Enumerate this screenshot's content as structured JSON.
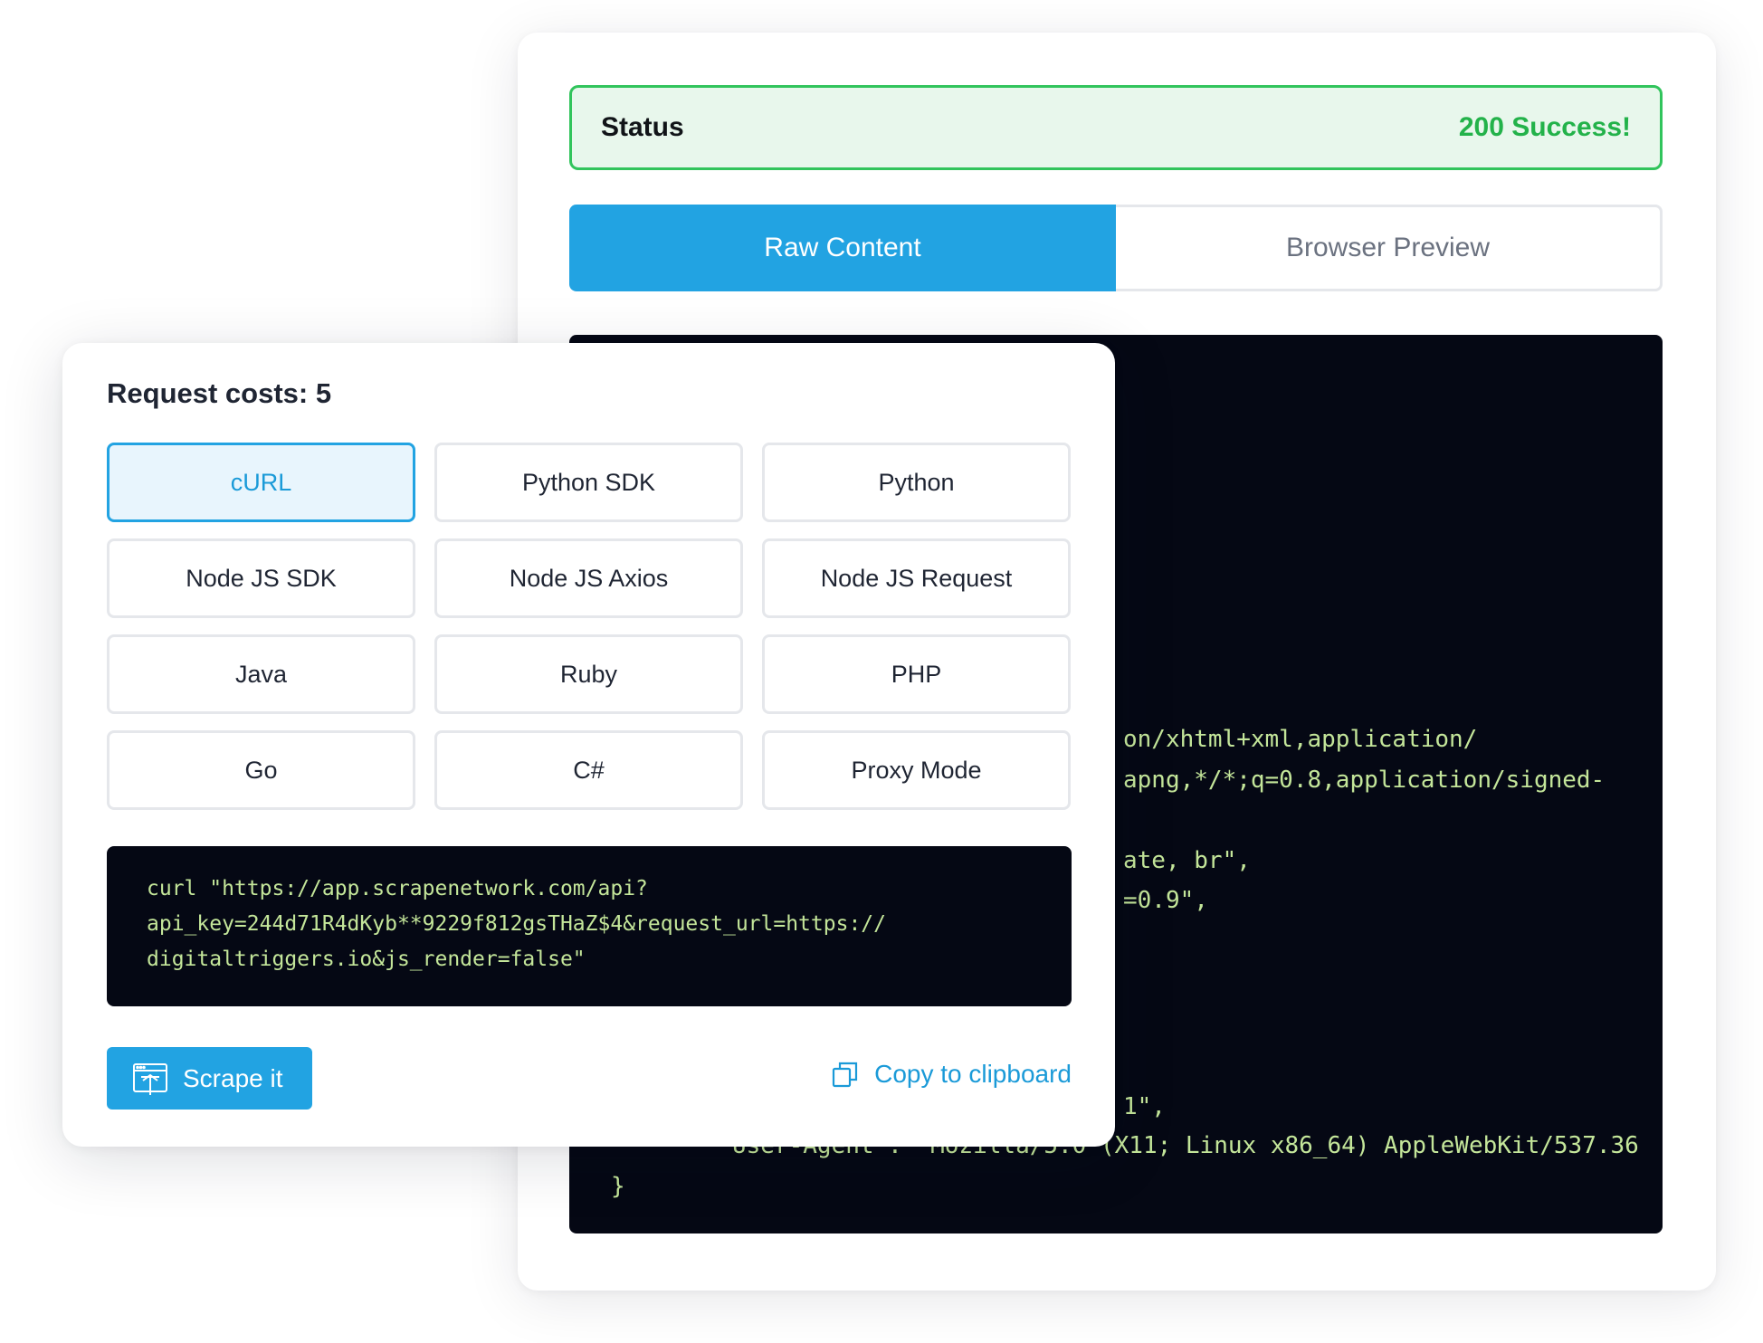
{
  "status": {
    "label": "Status",
    "value": "200 Success!"
  },
  "tabs": {
    "raw": "Raw Content",
    "preview": "Browser Preview",
    "active": "Raw Content"
  },
  "response_code": {
    "lines": [
      "on/xhtml+xml,application/",
      "apng,*/*;q=0.8,application/signed-",
      "ate, br\",",
      "=0.9\",",
      "1\",",
      "User-Agent\": \"Mozilla/5.0 (X11; Linux x86_64) AppleWebKit/537.36",
      "}"
    ]
  },
  "request": {
    "title": "Request costs: 5",
    "languages": [
      "cURL",
      "Python SDK",
      "Python",
      "Node JS SDK",
      "Node JS Axios",
      "Node JS Request",
      "Java",
      "Ruby",
      "PHP",
      "Go",
      "C#",
      "Proxy Mode"
    ],
    "selected_language": "cURL",
    "code_lines": [
      "curl \"https://app.scrapenetwork.com/api?",
      "api_key=244d71R4dKyb**9229f812gsTHaZ$4&request_url=https://",
      "digitaltriggers.io&js_render=false\""
    ],
    "scrape_label": "Scrape it",
    "copy_label": "Copy to clipboard"
  },
  "colors": {
    "accent": "#22a3e2",
    "success": "#23b24a",
    "code_bg": "#050814",
    "code_text": "#c4e69a"
  },
  "icons": {
    "scrape": "scrape-browser-icon",
    "copy": "copy-icon"
  }
}
